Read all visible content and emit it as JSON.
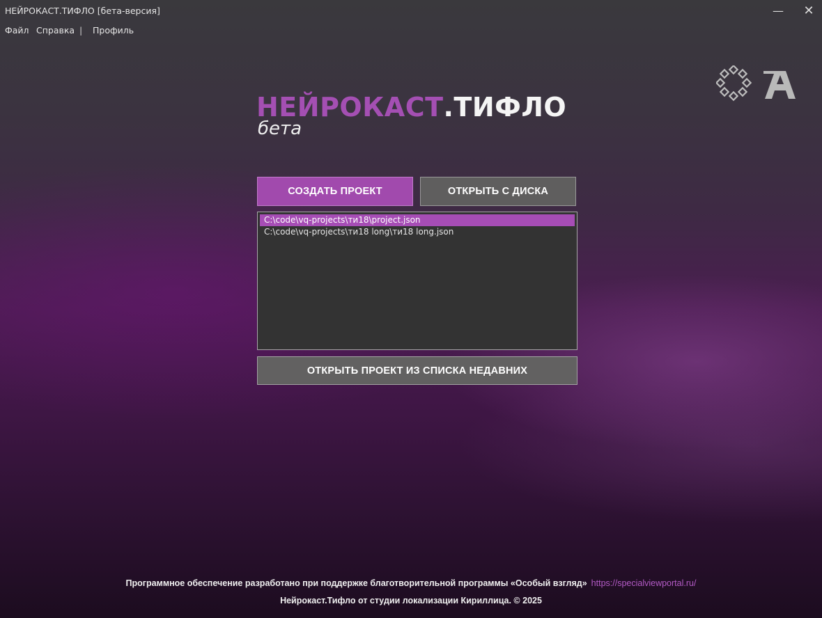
{
  "window": {
    "title": "НЕЙРОКАСТ.ТИФЛО [бета-версия]",
    "minimize_glyph": "—",
    "close_glyph": "✕"
  },
  "menu": {
    "items": [
      "Файл",
      "Справка",
      "Профиль"
    ],
    "separator": "|"
  },
  "top_icons": [
    "diamond-ring-icon",
    "a-letter-logo-icon"
  ],
  "logo": {
    "part_purple": "НЕЙРОКАСТ",
    "part_white": ".ТИФЛО",
    "subtitle": "бета"
  },
  "buttons": {
    "create_project": "СОЗДАТЬ ПРОЕКТ",
    "open_from_disk": "ОТКРЫТЬ С ДИСКА",
    "open_recent": "ОТКРЫТЬ ПРОЕКТ ИЗ СПИСКА НЕДАВНИХ"
  },
  "recent_projects": {
    "items": [
      "C:\\code\\vq-projects\\ти18\\project.json",
      "C:\\code\\vq-projects\\ти18 long\\ти18 long.json"
    ],
    "selected_index": 0
  },
  "footer": {
    "support_text": "Программное обеспечение разработано при поддержке благотворительной программы «Особый взгляд»",
    "support_link": "https://specialviewportal.ru/",
    "credits": "Нейрокаст.Тифло от студии локализации Кириллица. © 2025"
  },
  "colors": {
    "accent": "#a14aad",
    "button_gray": "#5f5e5e",
    "list_bg": "#333333",
    "link": "#b45bc6"
  }
}
